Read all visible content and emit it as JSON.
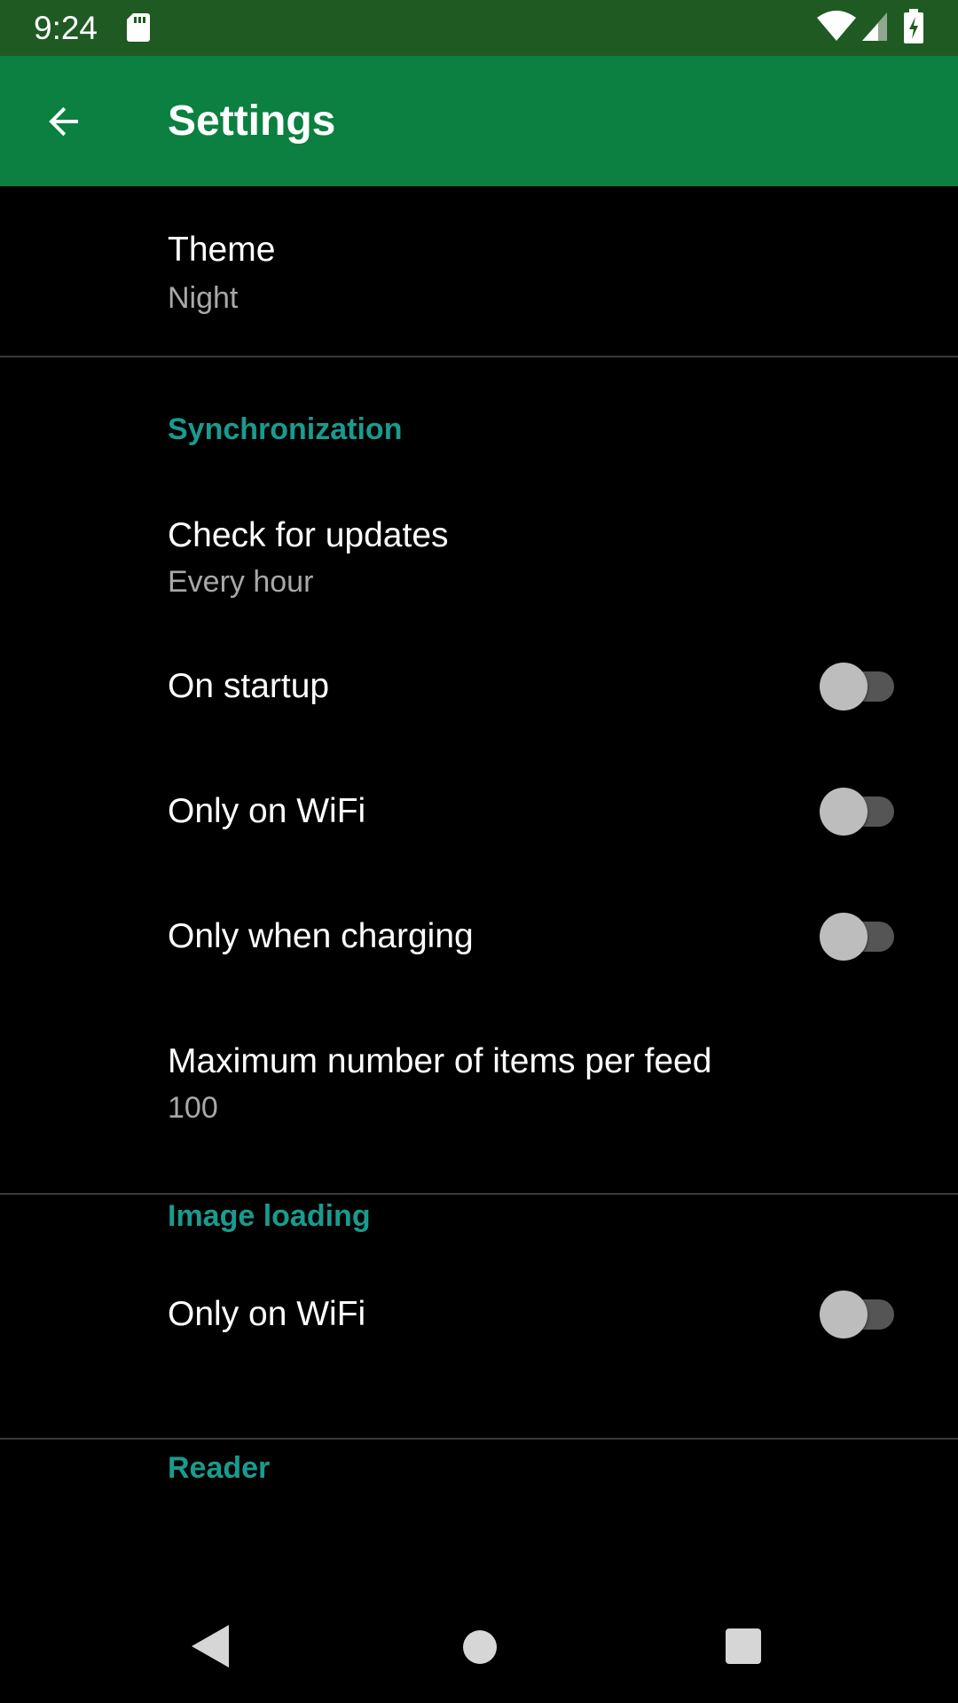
{
  "status_bar": {
    "time": "9:24",
    "icons": [
      "sd-card-icon",
      "wifi-icon",
      "signal-icon",
      "battery-charging-icon"
    ],
    "color": "#1f5a22"
  },
  "app_bar": {
    "title": "Settings",
    "back_icon": "arrow-back-icon",
    "color": "#0b8040"
  },
  "theme": {
    "title": "Theme",
    "summary": "Night"
  },
  "synchronization": {
    "header": "Synchronization",
    "check_updates": {
      "title": "Check for updates",
      "summary": "Every hour"
    },
    "on_startup": {
      "title": "On startup",
      "enabled": false
    },
    "only_wifi": {
      "title": "Only on WiFi",
      "enabled": false
    },
    "only_charging": {
      "title": "Only when charging",
      "enabled": false
    },
    "max_items": {
      "title": "Maximum number of items per feed",
      "summary": "100"
    }
  },
  "image_loading": {
    "header": "Image loading",
    "only_wifi": {
      "title": "Only on WiFi",
      "enabled": false
    }
  },
  "reader": {
    "header": "Reader"
  },
  "colors": {
    "accent": "#199b8f",
    "background": "#000000",
    "summary_text": "#a8a8a8"
  },
  "nav_bar": {
    "icons": [
      "nav-back-icon",
      "nav-home-icon",
      "nav-recents-icon"
    ]
  }
}
